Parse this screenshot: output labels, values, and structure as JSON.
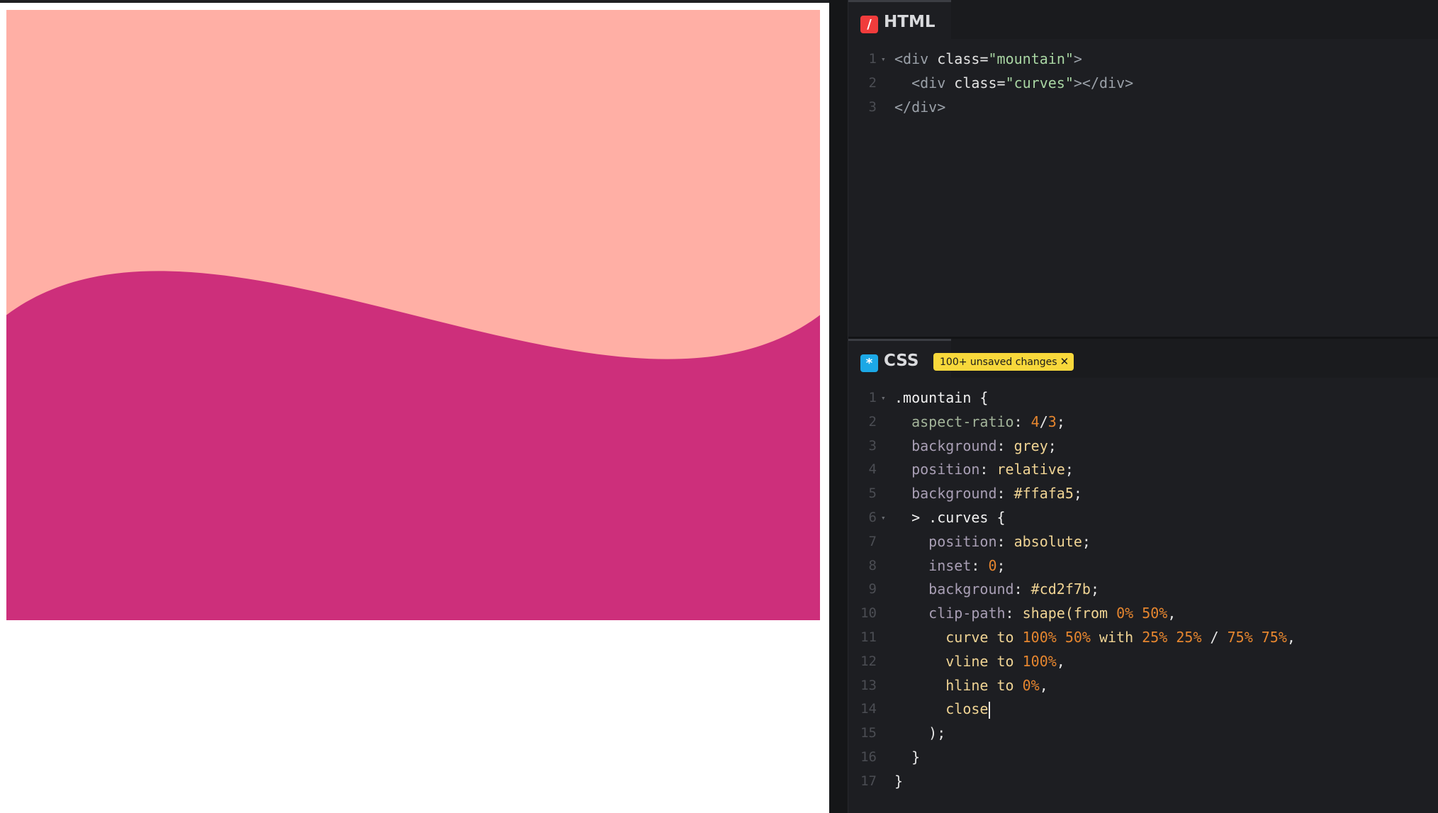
{
  "preview": {
    "background_color": "#ffafa5",
    "curve_color": "#cd2f7b",
    "aspect_ratio": "4/3"
  },
  "html_panel": {
    "tab_label": "HTML",
    "icon_glyph": "/",
    "lines": [
      {
        "n": "1",
        "fold": true,
        "tokens": [
          {
            "t": "<div ",
            "c": "tag"
          },
          {
            "t": "class",
            "c": "attr"
          },
          {
            "t": "=",
            "c": "pun"
          },
          {
            "t": "\"mountain\"",
            "c": "str"
          },
          {
            "t": ">",
            "c": "tag"
          }
        ]
      },
      {
        "n": "2",
        "fold": false,
        "tokens": [
          {
            "t": "  <div ",
            "c": "tag"
          },
          {
            "t": "class",
            "c": "attr"
          },
          {
            "t": "=",
            "c": "pun"
          },
          {
            "t": "\"curves\"",
            "c": "str"
          },
          {
            "t": "></div>",
            "c": "tag"
          }
        ]
      },
      {
        "n": "3",
        "fold": false,
        "tokens": [
          {
            "t": "</div>",
            "c": "tag"
          }
        ]
      }
    ]
  },
  "css_panel": {
    "tab_label": "CSS",
    "icon_glyph": "*",
    "badge_text": "100+ unsaved changes",
    "badge_close": "✕",
    "lines": [
      {
        "n": "1",
        "fold": true,
        "tokens": [
          {
            "t": ".mountain {",
            "c": "sel"
          }
        ]
      },
      {
        "n": "2",
        "fold": false,
        "tokens": [
          {
            "t": "  aspect-ratio",
            "c": "prop"
          },
          {
            "t": ": ",
            "c": "pun"
          },
          {
            "t": "4",
            "c": "num"
          },
          {
            "t": "/",
            "c": "pun"
          },
          {
            "t": "3",
            "c": "num"
          },
          {
            "t": ";",
            "c": "pun"
          }
        ]
      },
      {
        "n": "3",
        "fold": false,
        "tokens": [
          {
            "t": "  background",
            "c": "prop2"
          },
          {
            "t": ": ",
            "c": "pun"
          },
          {
            "t": "grey",
            "c": "val"
          },
          {
            "t": ";",
            "c": "pun"
          }
        ]
      },
      {
        "n": "4",
        "fold": false,
        "tokens": [
          {
            "t": "  position",
            "c": "prop2"
          },
          {
            "t": ": ",
            "c": "pun"
          },
          {
            "t": "relative",
            "c": "val"
          },
          {
            "t": ";",
            "c": "pun"
          }
        ]
      },
      {
        "n": "5",
        "fold": false,
        "tokens": [
          {
            "t": "  background",
            "c": "prop2"
          },
          {
            "t": ": ",
            "c": "pun"
          },
          {
            "t": "#ffafa5",
            "c": "val"
          },
          {
            "t": ";",
            "c": "pun"
          }
        ]
      },
      {
        "n": "6",
        "fold": true,
        "tokens": [
          {
            "t": "  > .curves {",
            "c": "sel"
          }
        ]
      },
      {
        "n": "7",
        "fold": false,
        "tokens": [
          {
            "t": "    position",
            "c": "prop2"
          },
          {
            "t": ": ",
            "c": "pun"
          },
          {
            "t": "absolute",
            "c": "val"
          },
          {
            "t": ";",
            "c": "pun"
          }
        ]
      },
      {
        "n": "8",
        "fold": false,
        "tokens": [
          {
            "t": "    inset",
            "c": "prop2"
          },
          {
            "t": ": ",
            "c": "pun"
          },
          {
            "t": "0",
            "c": "num"
          },
          {
            "t": ";",
            "c": "pun"
          }
        ]
      },
      {
        "n": "9",
        "fold": false,
        "tokens": [
          {
            "t": "    background",
            "c": "prop2"
          },
          {
            "t": ": ",
            "c": "pun"
          },
          {
            "t": "#cd2f7b",
            "c": "val"
          },
          {
            "t": ";",
            "c": "pun"
          }
        ]
      },
      {
        "n": "10",
        "fold": false,
        "tokens": [
          {
            "t": "    clip-path",
            "c": "prop2"
          },
          {
            "t": ": ",
            "c": "pun"
          },
          {
            "t": "shape(from ",
            "c": "val"
          },
          {
            "t": "0% 50%",
            "c": "num"
          },
          {
            "t": ",",
            "c": "pun"
          }
        ]
      },
      {
        "n": "11",
        "fold": false,
        "tokens": [
          {
            "t": "      curve to ",
            "c": "val"
          },
          {
            "t": "100% 50%",
            "c": "num"
          },
          {
            "t": " with ",
            "c": "val"
          },
          {
            "t": "25% 25%",
            "c": "num"
          },
          {
            "t": " / ",
            "c": "pun"
          },
          {
            "t": "75% 75%",
            "c": "num"
          },
          {
            "t": ",",
            "c": "pun"
          }
        ]
      },
      {
        "n": "12",
        "fold": false,
        "tokens": [
          {
            "t": "      vline to ",
            "c": "val"
          },
          {
            "t": "100%",
            "c": "num"
          },
          {
            "t": ",",
            "c": "pun"
          }
        ]
      },
      {
        "n": "13",
        "fold": false,
        "tokens": [
          {
            "t": "      hline to ",
            "c": "val"
          },
          {
            "t": "0%",
            "c": "num"
          },
          {
            "t": ",",
            "c": "pun"
          }
        ]
      },
      {
        "n": "14",
        "fold": false,
        "cursor": true,
        "tokens": [
          {
            "t": "      close",
            "c": "val"
          }
        ]
      },
      {
        "n": "15",
        "fold": false,
        "tokens": [
          {
            "t": "    );",
            "c": "pun"
          }
        ]
      },
      {
        "n": "16",
        "fold": false,
        "tokens": [
          {
            "t": "  }",
            "c": "pun"
          }
        ]
      },
      {
        "n": "17",
        "fold": false,
        "tokens": [
          {
            "t": "}",
            "c": "pun"
          }
        ]
      }
    ]
  }
}
